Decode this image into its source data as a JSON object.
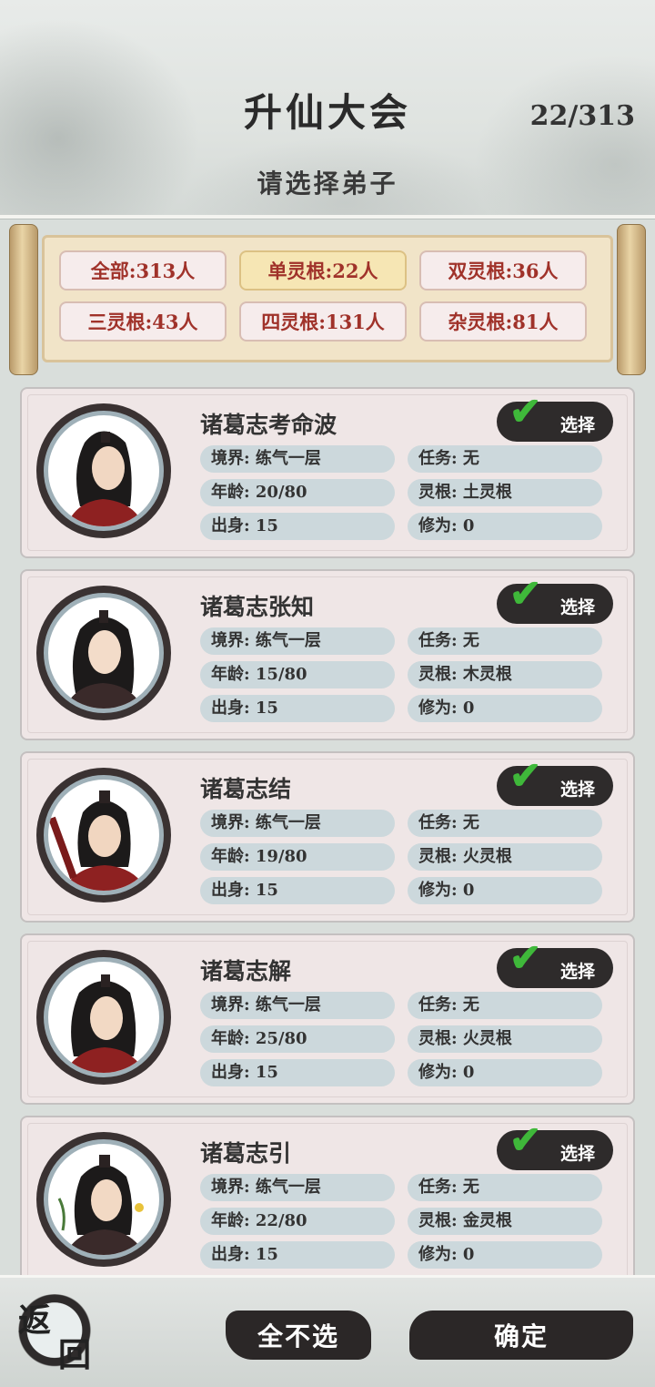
{
  "header": {
    "title": "升仙大会",
    "counter": "22/313",
    "subtitle": "请选择弟子"
  },
  "filters": [
    {
      "label": "全部:313人",
      "active": false
    },
    {
      "label": "单灵根:22人",
      "active": true
    },
    {
      "label": "双灵根:36人",
      "active": false
    },
    {
      "label": "三灵根:43人",
      "active": false
    },
    {
      "label": "四灵根:131人",
      "active": false
    },
    {
      "label": "杂灵根:81人",
      "active": false
    }
  ],
  "disciples": [
    {
      "name": "诸葛志考命波",
      "realm": "境界: 练气一层",
      "task": "任务: 无",
      "age": "年龄: 20/80",
      "root": "灵根: 土灵根",
      "origin": "出身: 15",
      "cultivation": "修为: 0",
      "select": "选择"
    },
    {
      "name": "诸葛志张知",
      "realm": "境界: 练气一层",
      "task": "任务: 无",
      "age": "年龄: 15/80",
      "root": "灵根: 木灵根",
      "origin": "出身: 15",
      "cultivation": "修为: 0",
      "select": "选择"
    },
    {
      "name": "诸葛志结",
      "realm": "境界: 练气一层",
      "task": "任务: 无",
      "age": "年龄: 19/80",
      "root": "灵根: 火灵根",
      "origin": "出身: 15",
      "cultivation": "修为: 0",
      "select": "选择"
    },
    {
      "name": "诸葛志解",
      "realm": "境界: 练气一层",
      "task": "任务: 无",
      "age": "年龄: 25/80",
      "root": "灵根: 火灵根",
      "origin": "出身: 15",
      "cultivation": "修为: 0",
      "select": "选择"
    },
    {
      "name": "诸葛志引",
      "realm": "境界: 练气一层",
      "task": "任务: 无",
      "age": "年龄: 22/80",
      "root": "灵根: 金灵根",
      "origin": "出身: 15",
      "cultivation": "修为: 0",
      "select": "选择"
    }
  ],
  "footer": {
    "back_char1": "返",
    "back_char2": "回",
    "deselect_all": "全不选",
    "confirm": "确定"
  },
  "colors": {
    "accent_red": "#a0322a",
    "check_green": "#3fb83a",
    "active_filter": "#f6e6b4"
  }
}
